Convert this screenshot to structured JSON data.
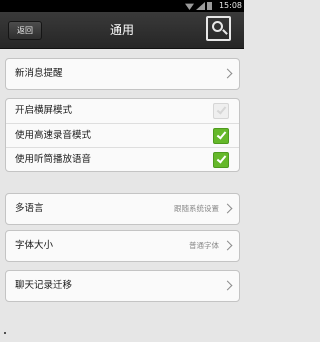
{
  "status_bar": {
    "time": "15:08"
  },
  "header": {
    "back_label": "返回",
    "title": "通用"
  },
  "settings": {
    "new_message_alert": "新消息提醒",
    "landscape_mode": {
      "label": "开启横屏模式",
      "checked": false
    },
    "fast_recording": {
      "label": "使用高速录音模式",
      "checked": true
    },
    "earpiece_playback": {
      "label": "使用听筒播放语音",
      "checked": true
    },
    "language": {
      "label": "多语言",
      "value": "跟随系统设置"
    },
    "font_size": {
      "label": "字体大小",
      "value": "普通字体"
    },
    "chat_migration": "聊天记录迁移"
  },
  "colors": {
    "check_on": "#65b82a",
    "title_bar": "#2e2e2e",
    "background": "#e6e6e6"
  }
}
